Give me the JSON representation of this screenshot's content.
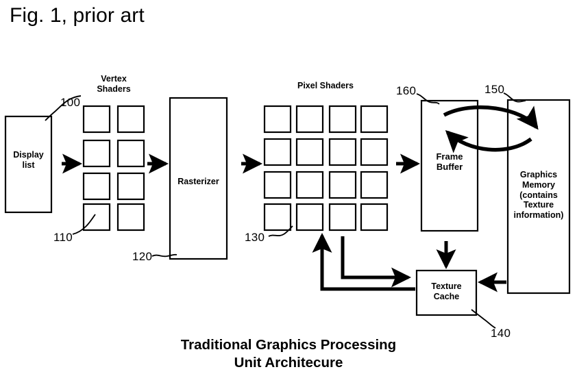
{
  "figure": {
    "title": "Fig. 1, prior art",
    "caption": "Traditional Graphics Processing\nUnit Architecure"
  },
  "blocks": {
    "display_list": {
      "label": "Display\nlist",
      "ref": "100"
    },
    "vertex_shaders": {
      "label": "Vertex\nShaders",
      "ref": "110",
      "rows": 4,
      "cols": 2
    },
    "rasterizer": {
      "label": "Rasterizer",
      "ref": "120"
    },
    "pixel_shaders": {
      "label": "Pixel Shaders",
      "ref": "130",
      "rows": 4,
      "cols": 4
    },
    "texture_cache": {
      "label": "Texture\nCache",
      "ref": "140"
    },
    "graphics_memory": {
      "label": "Graphics\nMemory\n(contains\nTexture\ninformation)",
      "ref": "150"
    },
    "frame_buffer": {
      "label": "Frame\nBuffer",
      "ref": "160"
    }
  },
  "colors": {
    "ink": "#000000",
    "paper": "#ffffff"
  }
}
